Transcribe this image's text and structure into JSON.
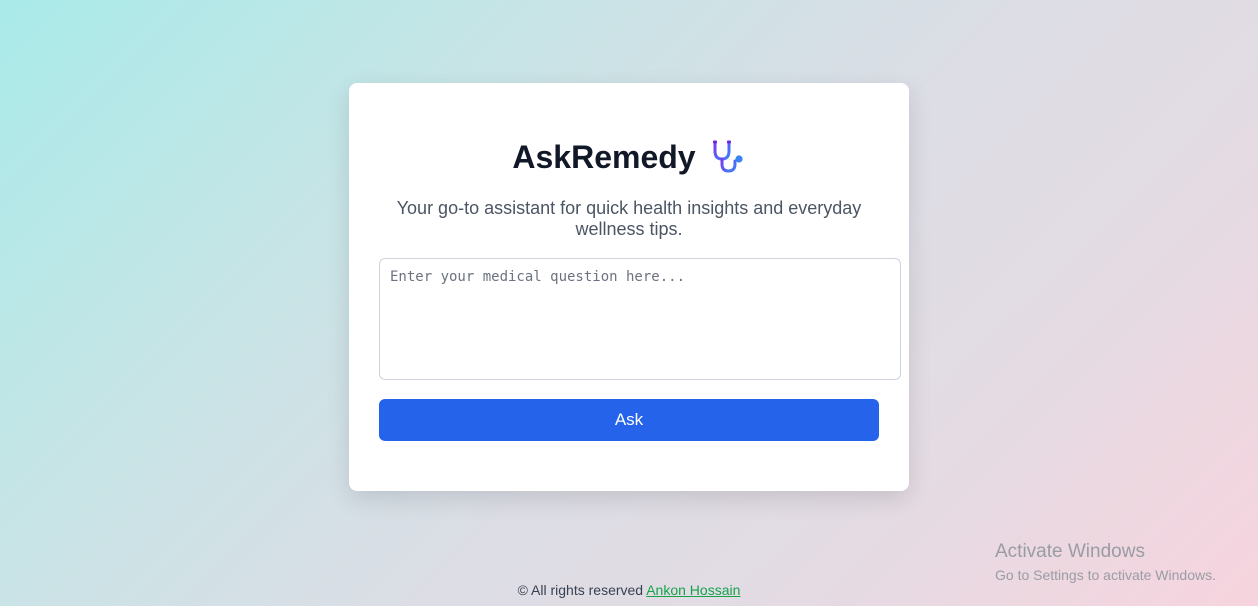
{
  "app": {
    "title": "AskRemedy",
    "title_icon": "stethoscope-icon",
    "subtitle": "Your go-to assistant for quick health insights and everyday wellness tips."
  },
  "form": {
    "question_placeholder": "Enter your medical question here...",
    "question_value": "",
    "ask_label": "Ask"
  },
  "footer": {
    "prefix": "© All rights reserved",
    "author_link": "Ankon Hossain"
  },
  "os_watermark": {
    "title": "Activate Windows",
    "subtitle": "Go to Settings to activate Windows."
  },
  "colors": {
    "accent": "#2563eb",
    "link": "#16a34a",
    "title": "#111827",
    "icon_gradient_start": "#7c3aed",
    "icon_gradient_end": "#3b82f6"
  }
}
